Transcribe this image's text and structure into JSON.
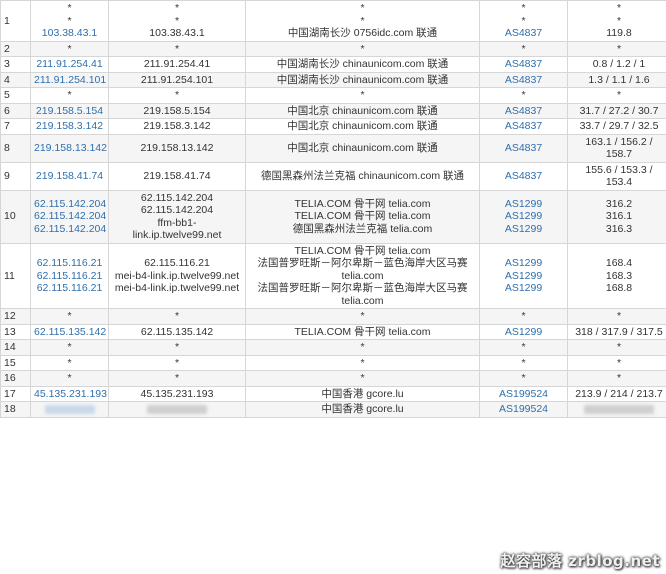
{
  "hops": [
    {
      "hop": "1",
      "ip_lines": [
        "*",
        "*",
        "103.38.43.1"
      ],
      "host_lines": [
        "*",
        "*",
        "103.38.43.1"
      ],
      "loc_lines": [
        "*",
        "*",
        "中国湖南长沙 0756idc.com 联通"
      ],
      "asn_lines": [
        "*",
        "*",
        "AS4837"
      ],
      "lat_lines": [
        "*",
        "*",
        "119.8"
      ]
    },
    {
      "hop": "2",
      "ip_lines": [
        "*"
      ],
      "host_lines": [
        "*"
      ],
      "loc_lines": [
        "*"
      ],
      "asn_lines": [
        "*"
      ],
      "lat_lines": [
        "*"
      ]
    },
    {
      "hop": "3",
      "ip_lines": [
        "211.91.254.41"
      ],
      "host_lines": [
        "211.91.254.41"
      ],
      "loc_lines": [
        "中国湖南长沙 chinaunicom.com 联通"
      ],
      "asn_lines": [
        "AS4837"
      ],
      "lat_lines": [
        "0.8 / 1.2 / 1"
      ]
    },
    {
      "hop": "4",
      "ip_lines": [
        "211.91.254.101"
      ],
      "host_lines": [
        "211.91.254.101"
      ],
      "loc_lines": [
        "中国湖南长沙 chinaunicom.com 联通"
      ],
      "asn_lines": [
        "AS4837"
      ],
      "lat_lines": [
        "1.3 / 1.1 / 1.6"
      ]
    },
    {
      "hop": "5",
      "ip_lines": [
        "*"
      ],
      "host_lines": [
        "*"
      ],
      "loc_lines": [
        "*"
      ],
      "asn_lines": [
        "*"
      ],
      "lat_lines": [
        "*"
      ]
    },
    {
      "hop": "6",
      "ip_lines": [
        "219.158.5.154"
      ],
      "host_lines": [
        "219.158.5.154"
      ],
      "loc_lines": [
        "中国北京 chinaunicom.com 联通"
      ],
      "asn_lines": [
        "AS4837"
      ],
      "lat_lines": [
        "31.7 / 27.2 / 30.7"
      ]
    },
    {
      "hop": "7",
      "ip_lines": [
        "219.158.3.142"
      ],
      "host_lines": [
        "219.158.3.142"
      ],
      "loc_lines": [
        "中国北京 chinaunicom.com 联通"
      ],
      "asn_lines": [
        "AS4837"
      ],
      "lat_lines": [
        "33.7 / 29.7 / 32.5"
      ]
    },
    {
      "hop": "8",
      "ip_lines": [
        "219.158.13.142"
      ],
      "host_lines": [
        "219.158.13.142"
      ],
      "loc_lines": [
        "中国北京 chinaunicom.com 联通"
      ],
      "asn_lines": [
        "AS4837"
      ],
      "lat_lines": [
        "163.1 / 156.2 /",
        "158.7"
      ]
    },
    {
      "hop": "9",
      "ip_lines": [
        "219.158.41.74"
      ],
      "host_lines": [
        "219.158.41.74"
      ],
      "loc_lines": [
        "德国黑森州法兰克福 chinaunicom.com 联通"
      ],
      "asn_lines": [
        "AS4837"
      ],
      "lat_lines": [
        "155.6 / 153.3 /",
        "153.4"
      ]
    },
    {
      "hop": "10",
      "ip_lines": [
        "62.115.142.204",
        "62.115.142.204",
        "62.115.142.204"
      ],
      "host_lines": [
        "62.115.142.204",
        "62.115.142.204",
        "ffm-bb1-",
        "link.ip.twelve99.net"
      ],
      "loc_lines": [
        "TELIA.COM 骨干网 telia.com",
        "TELIA.COM 骨干网 telia.com",
        "德国黑森州法兰克福 telia.com"
      ],
      "asn_lines": [
        "AS1299",
        "AS1299",
        "AS1299"
      ],
      "lat_lines": [
        "316.2",
        "316.1",
        "316.3"
      ]
    },
    {
      "hop": "11",
      "ip_lines": [
        "62.115.116.21",
        "62.115.116.21",
        "62.115.116.21"
      ],
      "host_lines": [
        "62.115.116.21",
        "mei-b4-link.ip.twelve99.net",
        "mei-b4-link.ip.twelve99.net"
      ],
      "loc_lines": [
        "TELIA.COM 骨干网 telia.com",
        "法国普罗旺斯－阿尔卑斯－蓝色海岸大区马赛",
        "telia.com",
        "法国普罗旺斯－阿尔卑斯－蓝色海岸大区马赛",
        "telia.com"
      ],
      "asn_lines": [
        "AS1299",
        "AS1299",
        "AS1299"
      ],
      "lat_lines": [
        "168.4",
        "168.3",
        "168.8"
      ]
    },
    {
      "hop": "12",
      "ip_lines": [
        "*"
      ],
      "host_lines": [
        "*"
      ],
      "loc_lines": [
        "*"
      ],
      "asn_lines": [
        "*"
      ],
      "lat_lines": [
        "*"
      ]
    },
    {
      "hop": "13",
      "ip_lines": [
        "62.115.135.142"
      ],
      "host_lines": [
        "62.115.135.142"
      ],
      "loc_lines": [
        "TELIA.COM 骨干网 telia.com"
      ],
      "asn_lines": [
        "AS1299"
      ],
      "lat_lines": [
        "318 / 317.9 / 317.5"
      ]
    },
    {
      "hop": "14",
      "ip_lines": [
        "*"
      ],
      "host_lines": [
        "*"
      ],
      "loc_lines": [
        "*"
      ],
      "asn_lines": [
        "*"
      ],
      "lat_lines": [
        "*"
      ]
    },
    {
      "hop": "15",
      "ip_lines": [
        "*"
      ],
      "host_lines": [
        "*"
      ],
      "loc_lines": [
        "*"
      ],
      "asn_lines": [
        "*"
      ],
      "lat_lines": [
        "*"
      ]
    },
    {
      "hop": "16",
      "ip_lines": [
        "*"
      ],
      "host_lines": [
        "*"
      ],
      "loc_lines": [
        "*"
      ],
      "asn_lines": [
        "*"
      ],
      "lat_lines": [
        "*"
      ]
    },
    {
      "hop": "17",
      "ip_lines": [
        "45.135.231.193"
      ],
      "host_lines": [
        "45.135.231.193"
      ],
      "loc_lines": [
        "中国香港 gcore.lu"
      ],
      "asn_lines": [
        "AS199524"
      ],
      "lat_lines": [
        "213.9 / 214 / 213.7"
      ]
    },
    {
      "hop": "18",
      "ip_lines": [],
      "host_lines": [],
      "loc_lines": [
        "中国香港 gcore.lu"
      ],
      "asn_lines": [
        "AS199524"
      ],
      "lat_lines": [],
      "redacted": true
    }
  ],
  "colors": {
    "link": "#2f6fad",
    "text": "#333333",
    "border": "#d6d6d6",
    "row_alt": "#f5f5f5"
  }
}
